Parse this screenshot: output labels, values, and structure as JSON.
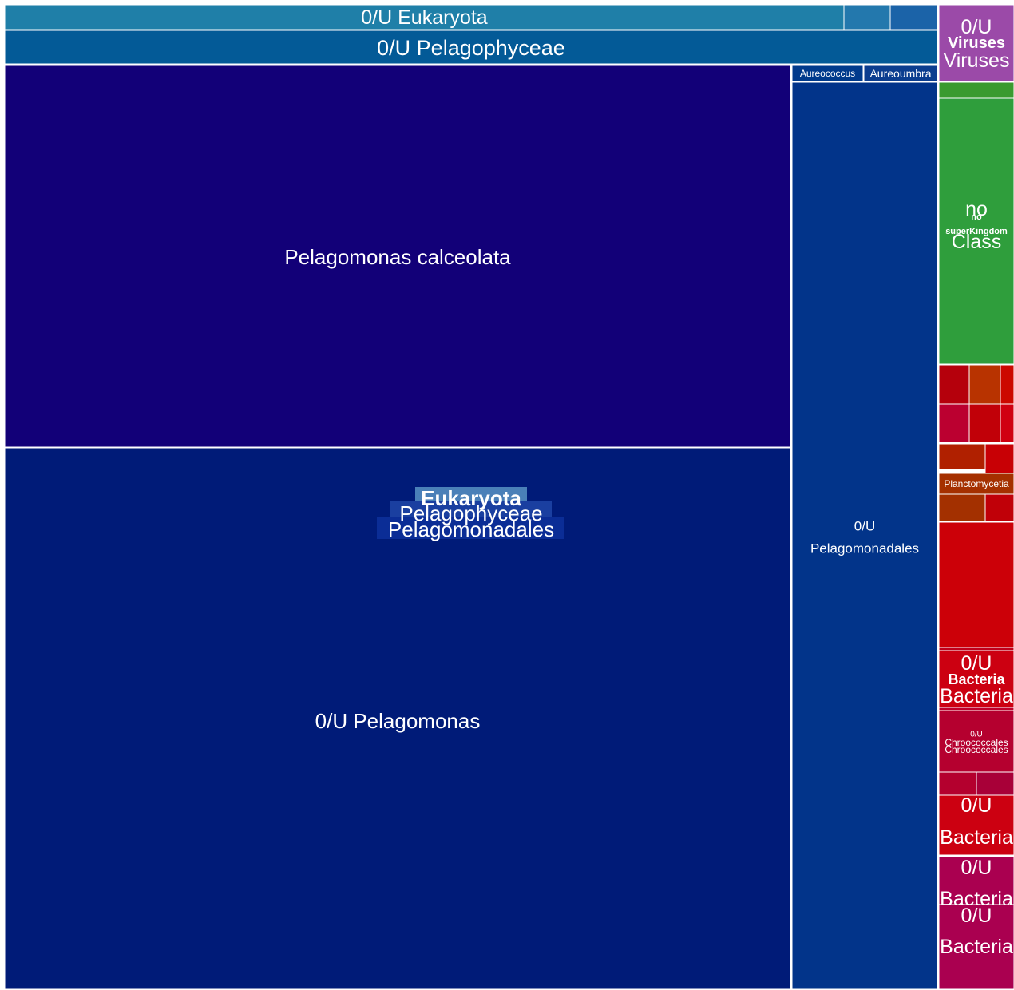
{
  "chart_data": {
    "type": "treemap",
    "colors": {
      "eukaryota_header": "#1f7fa8",
      "pelagophyceae_header": "#035a97",
      "calceolata": "#120078",
      "pelagomonas": "#001b78",
      "pelagomonadales": "#02348a",
      "aureococcus": "#003a8c",
      "aureoumbra": "#0b3d8f",
      "eukaryota_small_a": "#2378ad",
      "eukaryota_small_b": "#1b63a8",
      "viruses": "#9b4aa8",
      "no_superkingdom": "#2f9e3c",
      "bacteria_primary": "#cc0011",
      "bacteria_secondary": "#b5002f",
      "bacteria_tertiary": "#aa0050",
      "planctomycetia": "#a53000"
    },
    "tiles": [
      {
        "id": "eukaryota-header",
        "labels": [
          {
            "text": "0/U Eukaryota"
          }
        ]
      },
      {
        "id": "eukaryota-small-a",
        "labels": []
      },
      {
        "id": "eukaryota-small-b",
        "labels": []
      },
      {
        "id": "pelagophyceae-header",
        "labels": [
          {
            "text": "0/U Pelagophyceae"
          }
        ]
      },
      {
        "id": "pelagomonas-calceolata",
        "labels": [
          {
            "text": "Pelagomonas calceolata"
          }
        ]
      },
      {
        "id": "pelagomonas-ou",
        "labels": [
          {
            "text": "0/U Pelagomonas"
          }
        ]
      },
      {
        "id": "aureococcus",
        "labels": [
          {
            "text": "Aureococcus"
          }
        ]
      },
      {
        "id": "aureoumbra",
        "labels": [
          {
            "text": "Aureoumbra"
          }
        ]
      },
      {
        "id": "pelagomonadales-ou",
        "labels": [
          {
            "text": "0/U"
          },
          {
            "text": "Pelagomonadales"
          }
        ]
      },
      {
        "id": "viruses",
        "labels": [
          {
            "text": "0/U"
          },
          {
            "text": "Viruses",
            "bold": true
          },
          {
            "text": "Viruses"
          }
        ]
      },
      {
        "id": "no-superkingdom",
        "labels": [
          {
            "text": "no"
          },
          {
            "text": "no",
            "bold": true
          },
          {
            "text": "superKingdom",
            "bold": true
          },
          {
            "text": "Class"
          }
        ]
      },
      {
        "id": "planctomycetia",
        "labels": [
          {
            "text": "Planctomycetia"
          }
        ]
      },
      {
        "id": "bacteria-ou-a",
        "labels": [
          {
            "text": "0/U"
          },
          {
            "text": "Bacteria",
            "bold": true
          },
          {
            "text": "Bacteria"
          }
        ]
      },
      {
        "id": "chroococcales",
        "labels": [
          {
            "text": "0/U"
          },
          {
            "text": "Chroococcales"
          },
          {
            "text": "Chroococcales"
          }
        ]
      },
      {
        "id": "bacteria-ou-b",
        "labels": [
          {
            "text": "0/U"
          },
          {
            "text": "Bacteria"
          }
        ]
      },
      {
        "id": "bacteria-ou-c",
        "labels": [
          {
            "text": "0/U"
          },
          {
            "text": "Bacteria"
          }
        ]
      },
      {
        "id": "bacteria-ou-d",
        "labels": [
          {
            "text": "0/U"
          },
          {
            "text": "Bacteria"
          }
        ]
      }
    ],
    "group_labels": [
      {
        "id": "eukaryota",
        "text": "Eukaryota",
        "bold": true
      },
      {
        "id": "pelagophyceae",
        "text": "Pelagophyceae"
      },
      {
        "id": "pelagomonadales",
        "text": "Pelagomonadales"
      }
    ]
  }
}
